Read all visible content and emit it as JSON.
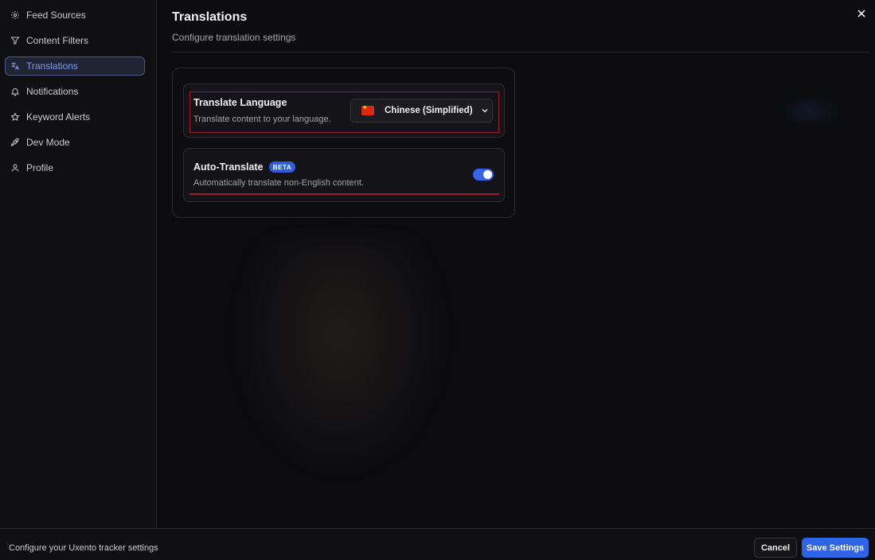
{
  "sidebar": {
    "items": [
      {
        "label": "Feed Sources",
        "icon": "gear-icon"
      },
      {
        "label": "Content Filters",
        "icon": "filter-icon"
      },
      {
        "label": "Translations",
        "icon": "translate-icon",
        "active": true
      },
      {
        "label": "Notifications",
        "icon": "bell-icon"
      },
      {
        "label": "Keyword Alerts",
        "icon": "star-icon"
      },
      {
        "label": "Dev Mode",
        "icon": "rocket-icon"
      },
      {
        "label": "Profile",
        "icon": "user-icon"
      }
    ]
  },
  "header": {
    "title": "Translations",
    "subtitle": "Configure translation settings"
  },
  "settings": {
    "translate_language": {
      "title": "Translate Language",
      "description": "Translate content to your language.",
      "selected": "Chinese (Simplified)",
      "flag": "china-flag-icon"
    },
    "auto_translate": {
      "title": "Auto-Translate",
      "badge": "BETA",
      "description": "Automatically translate non-English content.",
      "enabled": true
    }
  },
  "footer": {
    "text": "Configure your Uxento tracker settings",
    "cancel_label": "Cancel",
    "save_label": "Save Settings"
  },
  "colors": {
    "accent": "#2f64e8",
    "active_nav_text": "#7f9cf5",
    "highlight": "#a0182a"
  }
}
